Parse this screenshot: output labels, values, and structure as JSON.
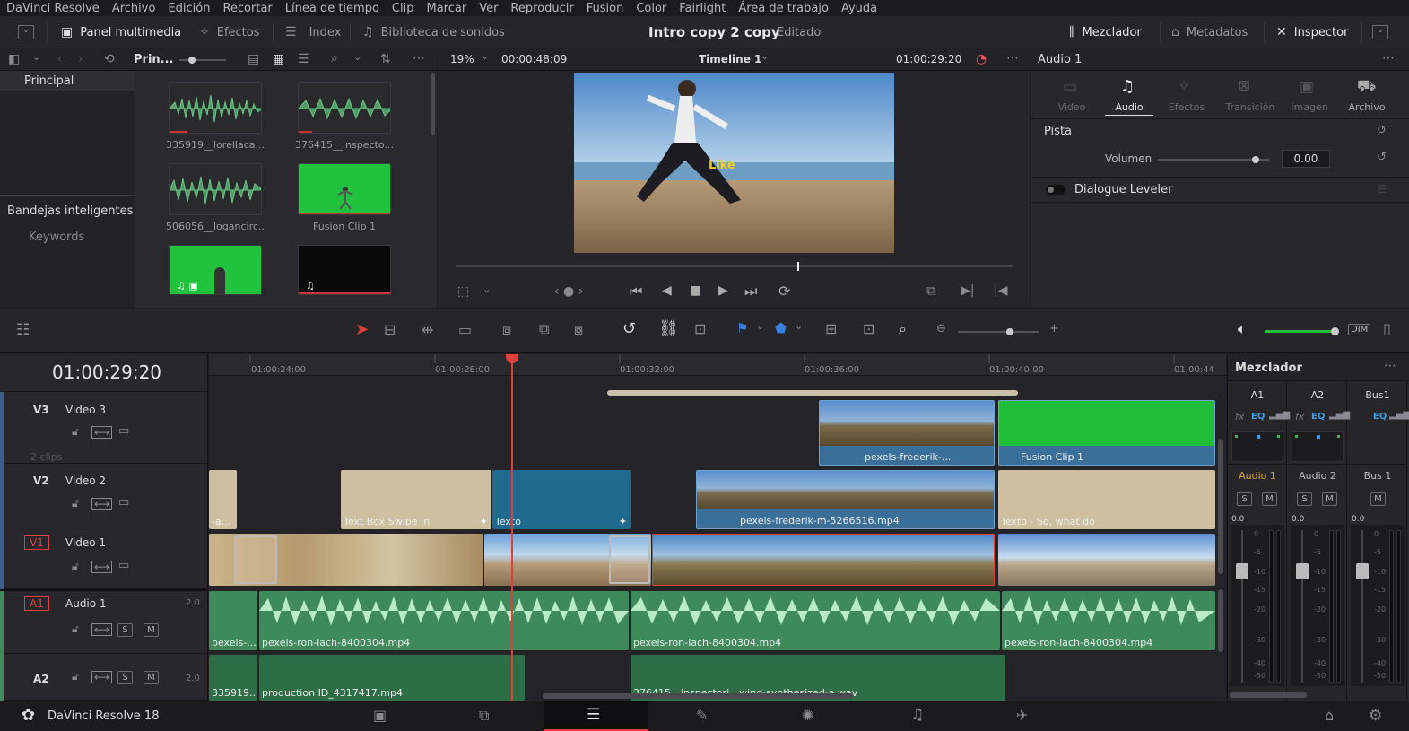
{
  "menu": [
    "DaVinci Resolve",
    "Archivo",
    "Edición",
    "Recortar",
    "Línea de tiempo",
    "Clip",
    "Marcar",
    "Ver",
    "Reproducir",
    "Fusion",
    "Color",
    "Fairlight",
    "Área de trabajo",
    "Ayuda"
  ],
  "toolbar": {
    "media_pool": "Panel multimedia",
    "effects": "Efectos",
    "index": "Index",
    "sound_library": "Biblioteca de sonidos",
    "project_title": "Intro copy 2 copy",
    "project_status": "Editado",
    "mixer": "Mezclador",
    "metadata": "Metadatos",
    "inspector": "Inspector"
  },
  "media": {
    "bin_short": "Prin...",
    "bins": [
      "Principal"
    ],
    "smart_bins_title": "Bandejas inteligentes",
    "smart_bins": [
      "Keywords"
    ],
    "clips": [
      {
        "name": "335919__lorellaca...",
        "kind": "audio"
      },
      {
        "name": "376415__inspecto...",
        "kind": "audio"
      },
      {
        "name": "506056__logancirc...",
        "kind": "audio"
      },
      {
        "name": "Fusion Clip 1",
        "kind": "fusion"
      },
      {
        "name": "",
        "kind": "greenvideo"
      },
      {
        "name": "",
        "kind": "black"
      }
    ]
  },
  "viewer": {
    "zoom": "19%",
    "source_tc": "00:00:48:09",
    "timeline_name": "Timeline 1",
    "timeline_tc": "01:00:29:20",
    "overlay_text": "Like"
  },
  "inspector": {
    "title": "Audio 1",
    "tabs": [
      "Video",
      "Audio",
      "Efectos",
      "Transición",
      "Imagen",
      "Archivo"
    ],
    "active_tab": "Audio",
    "section": "Pista",
    "volume_label": "Volumen",
    "volume_value": "0.00",
    "volume_level": 0.88,
    "dialogue": "Dialogue Leveler"
  },
  "timeline": {
    "timecode": "01:00:29:20",
    "ruler": [
      "01:00:24:00",
      "01:00:28:00",
      "01:00:32:00",
      "01:00:36:00",
      "01:00:40:00",
      "01:00:44"
    ],
    "tracks": [
      {
        "id": "V3",
        "name": "Video 3",
        "note": "2 clips"
      },
      {
        "id": "V2",
        "name": "Video 2",
        "note": ""
      },
      {
        "id": "V1",
        "name": "Video 1",
        "note": ""
      },
      {
        "id": "A1",
        "name": "Audio 1",
        "ch": "2.0"
      },
      {
        "id": "A2",
        "name": "Audio 2",
        "ch": "2.0"
      }
    ],
    "solo": "S",
    "mute": "M",
    "dim": "DIM",
    "clips": {
      "v3_a": "pexels-frederik-...",
      "v3_b": "Fusion Clip 1",
      "v2_a": "-a...",
      "v2_b": "Text Box Swipe In",
      "v2_c": "Texto",
      "v2_d": "pexels-frederik-m-5266516.mp4",
      "v2_e": "Texto -  So, what  do",
      "a1_a": "pexels-...",
      "a1_b": "pexels-ron-lach-8400304.mp4",
      "a1_c": "pexels-ron-lach-8400304.mp4",
      "a1_d": "pexels-ron-lach-8400304.mp4",
      "a2_a": "335919...",
      "a2_b": "production ID_4317417.mp4",
      "a2_c": "376415__inspectorj__wind-synthesized-a.wav"
    }
  },
  "mixer": {
    "title": "Mezclador",
    "cols": [
      "A1",
      "A2",
      "Bus1"
    ],
    "labels": [
      "Audio 1",
      "Audio 2",
      "Bus 1"
    ],
    "levels": [
      "0.0",
      "0.0",
      "0.0"
    ],
    "scale": [
      "0",
      "-5",
      "-10",
      "-15",
      "-20",
      "-30",
      "-40",
      "-50"
    ],
    "fx": "fx",
    "eq": "EQ"
  },
  "bottom": {
    "app": "DaVinci Resolve 18"
  },
  "colors": {
    "accent_red": "#e0403a",
    "clip_blue": "#3a6f99",
    "audio_green": "#3e8a5a",
    "text_clip": "#cdbf9f",
    "green_screen": "#1fbf3a"
  }
}
